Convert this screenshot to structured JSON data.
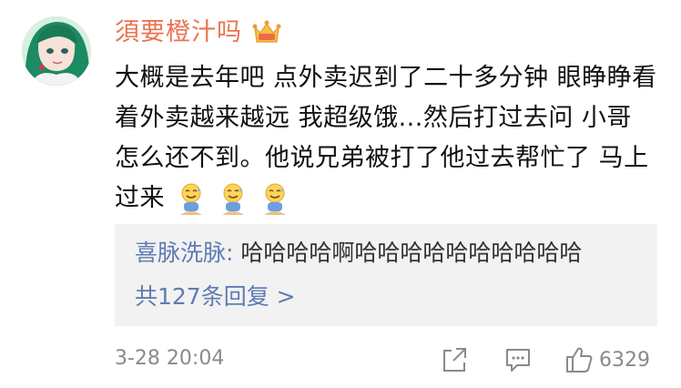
{
  "comment": {
    "username": "須要橙汁吗",
    "text": "大概是去年吧 点外卖迟到了二十多分钟 眼睁睁看着外卖越来越远 我超级饿...然后打过去问 小哥 怎么还不到。他说兄弟被打了他过去帮忙了 马上过来",
    "emojis": [
      "sweat-smile-emoji",
      "sweat-smile-emoji",
      "sweat-smile-emoji"
    ],
    "vip_icon": "crown-vip-icon"
  },
  "reply": {
    "user": "喜脉洗脉",
    "separator": ":",
    "text": "哈哈哈哈啊哈哈哈哈哈哈哈哈哈哈",
    "count_label": "共127条回复 >"
  },
  "footer": {
    "timestamp": "3-28 20:04",
    "like_count": "6329",
    "icons": [
      "share-icon",
      "comment-icon",
      "like-icon"
    ]
  },
  "colors": {
    "username": "#eb7350",
    "link": "#5f7bb4",
    "meta": "#8a8a8a",
    "reply_bg": "#f2f2f2"
  }
}
